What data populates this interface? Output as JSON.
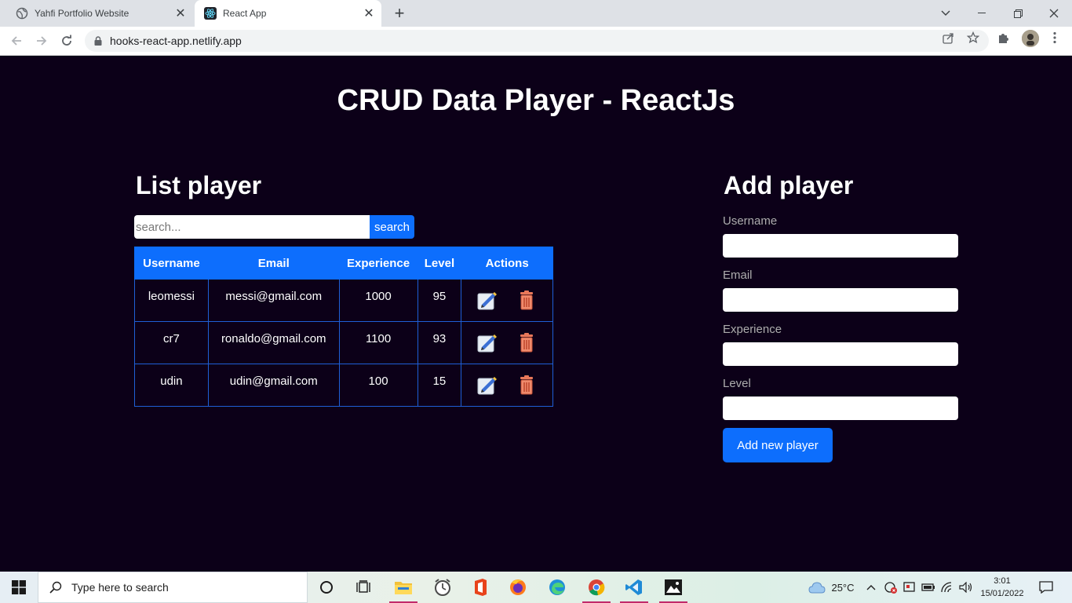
{
  "browser": {
    "tabs": [
      {
        "title": "Yahfi Portfolio Website",
        "active": false
      },
      {
        "title": "React App",
        "active": true
      }
    ],
    "url": "hooks-react-app.netlify.app"
  },
  "page": {
    "title": "CRUD Data Player - ReactJs",
    "list_heading": "List player",
    "search": {
      "placeholder": "search...",
      "button": "search"
    },
    "table": {
      "headers": [
        "Username",
        "Email",
        "Experience",
        "Level",
        "Actions"
      ],
      "rows": [
        {
          "username": "leomessi",
          "email": "messi@gmail.com",
          "experience": "1000",
          "level": "95"
        },
        {
          "username": "cr7",
          "email": "ronaldo@gmail.com",
          "experience": "1100",
          "level": "93"
        },
        {
          "username": "udin",
          "email": "udin@gmail.com",
          "experience": "100",
          "level": "15"
        }
      ]
    },
    "form": {
      "heading": "Add player",
      "labels": {
        "username": "Username",
        "email": "Email",
        "experience": "Experience",
        "level": "Level"
      },
      "submit": "Add new player"
    }
  },
  "taskbar": {
    "search_placeholder": "Type here to search",
    "temperature": "25°C",
    "time": "3:01",
    "date": "15/01/2022"
  },
  "colors": {
    "page_bg": "#0c0018",
    "accent": "#0d6efd"
  }
}
